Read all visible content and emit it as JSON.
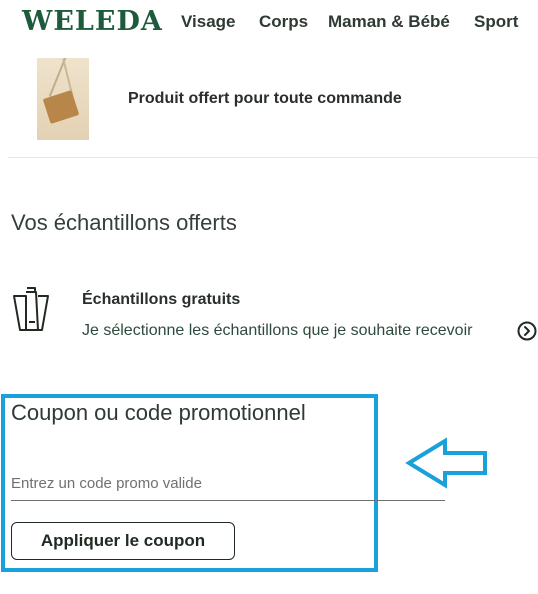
{
  "header": {
    "logo": "WELEDA",
    "nav": [
      "Visage",
      "Corps",
      "Maman & Bébé",
      "Sport"
    ]
  },
  "gift": {
    "text": "Produit offert pour toute commande"
  },
  "samples": {
    "title": "Vos échantillons offerts",
    "heading": "Échantillons gratuits",
    "link": "Je sélectionne les échantillons que je souhaite recevoir"
  },
  "coupon": {
    "title": "Coupon ou code promotionnel",
    "placeholder": "Entrez un code promo valide",
    "value": "",
    "button": "Appliquer le coupon"
  },
  "colors": {
    "brand": "#1e5a3c",
    "highlight": "#1aa0da"
  },
  "icons": {
    "samples": "tubes-icon",
    "link_arrow": "circle-arrow-right-icon",
    "pointer": "arrow-left-outline-icon"
  }
}
